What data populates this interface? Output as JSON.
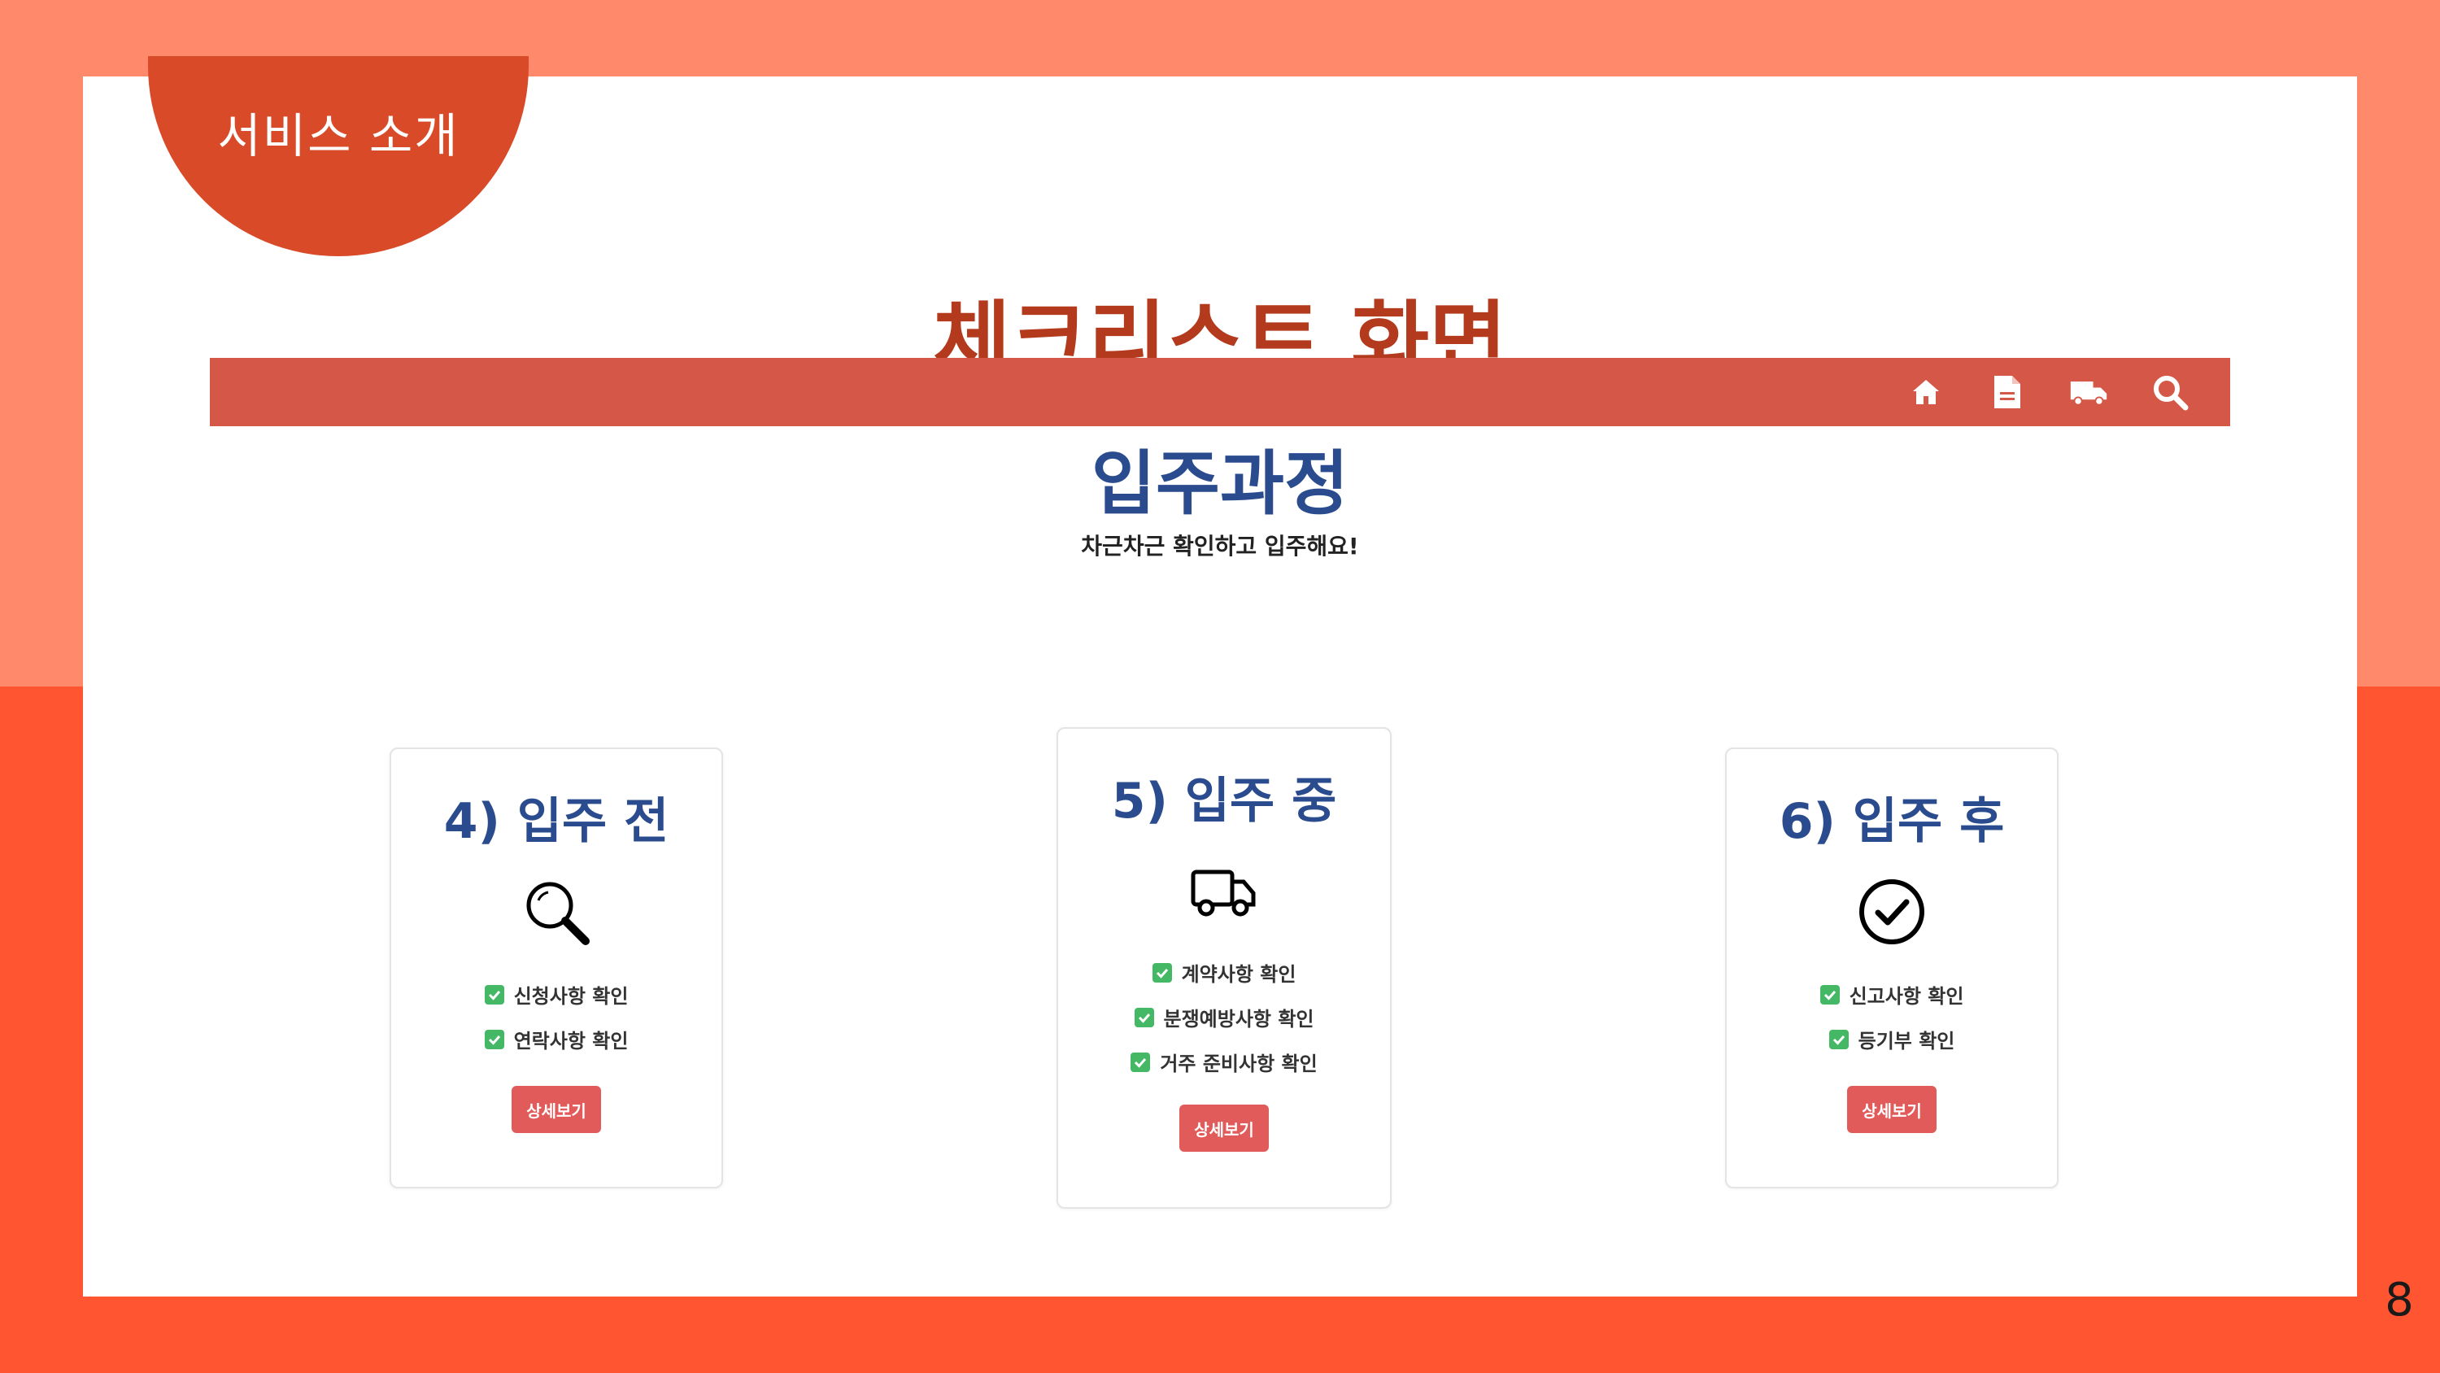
{
  "badge": {
    "label": "서비스 소개"
  },
  "slide": {
    "title": "체크리스트 화면",
    "page_number": "8"
  },
  "navbar": {
    "icons": [
      "home-icon",
      "document-icon",
      "truck-icon",
      "search-icon"
    ]
  },
  "hero": {
    "title": "입주과정",
    "subtitle": "차근차근 확인하고 입주해요!"
  },
  "cards": [
    {
      "title": "4) 입주 전",
      "icon": "magnifier-icon",
      "items": [
        "신청사항 확인",
        "연락사항 확인"
      ],
      "button": "상세보기"
    },
    {
      "title": "5) 입주 중",
      "icon": "truck-icon",
      "items": [
        "계약사항 확인",
        "분쟁예방사항 확인",
        "거주 준비사항 확인"
      ],
      "button": "상세보기"
    },
    {
      "title": "6) 입주 후",
      "icon": "check-circle-icon",
      "items": [
        "신고사항 확인",
        "등기부 확인"
      ],
      "button": "상세보기"
    }
  ],
  "colors": {
    "background_top": "#FF8A6B",
    "background_bottom": "#FF5530",
    "badge": "#D84A28",
    "title": "#B33A1C",
    "navbar": "#D45747",
    "heading_blue": "#2A4C8E",
    "check_green": "#45B866",
    "button_red": "#E25B5B"
  }
}
